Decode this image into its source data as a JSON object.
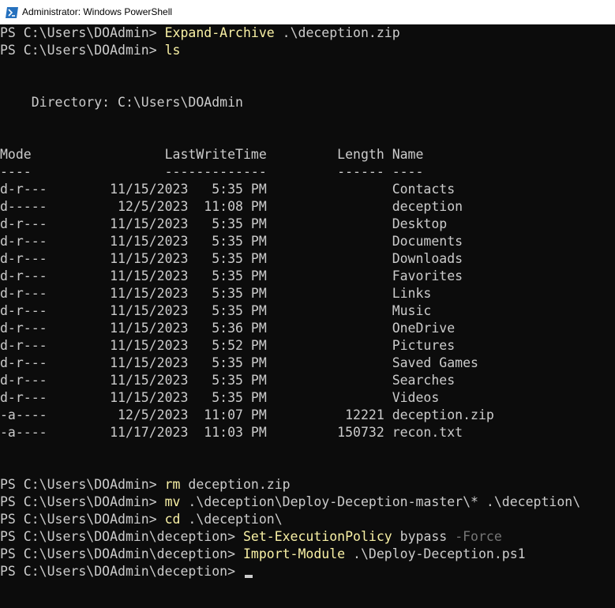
{
  "window": {
    "title": "Administrator: Windows PowerShell"
  },
  "colors": {
    "background": "#0c0c0c",
    "foreground": "#cccccc",
    "command": "#f9f1a5",
    "parameter": "#767676"
  },
  "console": {
    "line1": {
      "prompt": "PS C:\\Users\\DOAdmin> ",
      "command": "Expand-Archive",
      "args": " .\\deception.zip"
    },
    "line2": {
      "prompt": "PS C:\\Users\\DOAdmin> ",
      "command": "ls",
      "args": ""
    },
    "directory_label": "    Directory: C:\\Users\\DOAdmin",
    "table_header": "Mode                 LastWriteTime         Length Name",
    "table_rule": "----                 -------------         ------ ----",
    "rows": [
      "d-r---        11/15/2023   5:35 PM                Contacts",
      "d-----         12/5/2023  11:08 PM                deception",
      "d-r---        11/15/2023   5:35 PM                Desktop",
      "d-r---        11/15/2023   5:35 PM                Documents",
      "d-r---        11/15/2023   5:35 PM                Downloads",
      "d-r---        11/15/2023   5:35 PM                Favorites",
      "d-r---        11/15/2023   5:35 PM                Links",
      "d-r---        11/15/2023   5:35 PM                Music",
      "d-r---        11/15/2023   5:36 PM                OneDrive",
      "d-r---        11/15/2023   5:52 PM                Pictures",
      "d-r---        11/15/2023   5:35 PM                Saved Games",
      "d-r---        11/15/2023   5:35 PM                Searches",
      "d-r---        11/15/2023   5:35 PM                Videos",
      "-a----         12/5/2023  11:07 PM          12221 deception.zip",
      "-a----        11/17/2023  11:03 PM         150732 recon.txt"
    ],
    "line3": {
      "prompt": "PS C:\\Users\\DOAdmin> ",
      "command": "rm",
      "args": " deception.zip"
    },
    "line4": {
      "prompt": "PS C:\\Users\\DOAdmin> ",
      "command": "mv",
      "args": " .\\deception\\Deploy-Deception-master\\* .\\deception\\"
    },
    "line5": {
      "prompt": "PS C:\\Users\\DOAdmin> ",
      "command": "cd",
      "args": " .\\deception\\"
    },
    "line6": {
      "prompt": "PS C:\\Users\\DOAdmin\\deception> ",
      "command": "Set-ExecutionPolicy",
      "args": " bypass ",
      "param": "-Force"
    },
    "line7": {
      "prompt": "PS C:\\Users\\DOAdmin\\deception> ",
      "command": "Import-Module",
      "args": " .\\Deploy-Deception.ps1"
    },
    "line8": {
      "prompt": "PS C:\\Users\\DOAdmin\\deception> "
    }
  }
}
